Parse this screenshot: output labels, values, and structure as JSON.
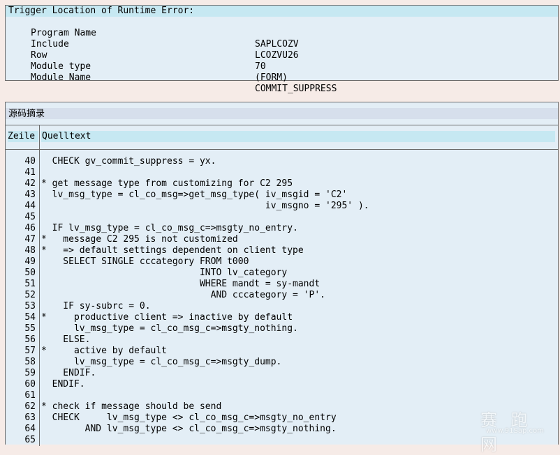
{
  "error_location": {
    "header": "Trigger Location of Runtime Error:",
    "rows": [
      {
        "label": "Program Name",
        "value": "SAPLCOZV"
      },
      {
        "label": "Include",
        "value": "LCOZVU26"
      },
      {
        "label": "Row",
        "value": "70"
      },
      {
        "label": "Module type",
        "value": "(FORM)"
      },
      {
        "label": "Module Name",
        "value": "COMMIT_SUPPRESS"
      }
    ]
  },
  "source_extract": {
    "title": "源码摘录",
    "col_line": "Zeile",
    "col_source": "Quelltext",
    "lines": [
      {
        "n": "40",
        "t": "  CHECK gv_commit_suppress = yx."
      },
      {
        "n": "41",
        "t": ""
      },
      {
        "n": "42",
        "t": "* get message type from customizing for C2 295"
      },
      {
        "n": "43",
        "t": "  lv_msg_type = cl_co_msg=>get_msg_type( iv_msgid = 'C2'"
      },
      {
        "n": "44",
        "t": "                                         iv_msgno = '295' )."
      },
      {
        "n": "45",
        "t": ""
      },
      {
        "n": "46",
        "t": "  IF lv_msg_type = cl_co_msg_c=>msgty_no_entry."
      },
      {
        "n": "47",
        "t": "*   message C2 295 is not customized"
      },
      {
        "n": "48",
        "t": "*   => default settings dependent on client type"
      },
      {
        "n": "49",
        "t": "    SELECT SINGLE cccategory FROM t000"
      },
      {
        "n": "50",
        "t": "                             INTO lv_category"
      },
      {
        "n": "51",
        "t": "                             WHERE mandt = sy-mandt"
      },
      {
        "n": "52",
        "t": "                               AND cccategory = 'P'."
      },
      {
        "n": "53",
        "t": "    IF sy-subrc = 0."
      },
      {
        "n": "54",
        "t": "*     productive client => inactive by default"
      },
      {
        "n": "55",
        "t": "      lv_msg_type = cl_co_msg_c=>msgty_nothing."
      },
      {
        "n": "56",
        "t": "    ELSE."
      },
      {
        "n": "57",
        "t": "*     active by default"
      },
      {
        "n": "58",
        "t": "      lv_msg_type = cl_co_msg_c=>msgty_dump."
      },
      {
        "n": "59",
        "t": "    ENDIF."
      },
      {
        "n": "60",
        "t": "  ENDIF."
      },
      {
        "n": "61",
        "t": ""
      },
      {
        "n": "62",
        "t": "* check if message should be send"
      },
      {
        "n": "63",
        "t": "  CHECK     lv_msg_type <> cl_co_msg_c=>msgty_no_entry"
      },
      {
        "n": "64",
        "t": "        AND lv_msg_type <> cl_co_msg_c=>msgty_nothing."
      },
      {
        "n": "65",
        "t": ""
      }
    ]
  },
  "watermark": {
    "text": "赛 跑 网",
    "url": "www.91Sap.com"
  }
}
